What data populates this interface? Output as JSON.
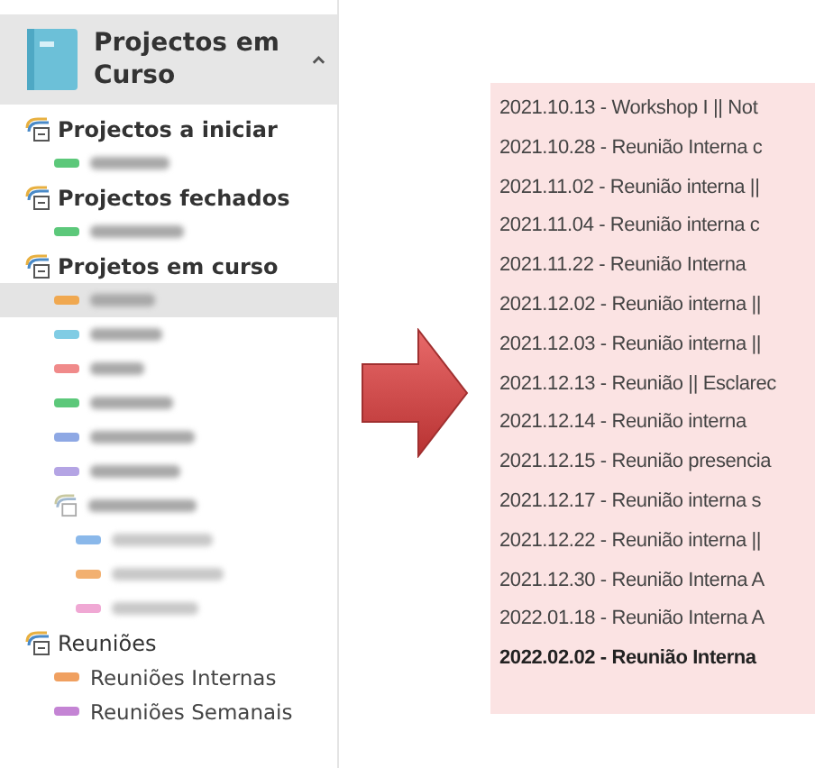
{
  "sidebar": {
    "header": {
      "title": "Projectos em Curso",
      "expanded": true
    },
    "sections": [
      {
        "label": "Projectos a iniciar",
        "bold": true,
        "children": [
          {
            "kind": "calendar",
            "color": "#5cc87a",
            "selected": false
          }
        ]
      },
      {
        "label": "Projectos fechados",
        "bold": true,
        "children": [
          {
            "kind": "calendar",
            "color": "#5cc87a",
            "selected": false
          }
        ]
      },
      {
        "label": "Projetos em curso",
        "bold": true,
        "children": [
          {
            "kind": "calendar",
            "color": "#f0a850",
            "selected": true
          },
          {
            "kind": "calendar",
            "color": "#80cce4",
            "selected": false
          },
          {
            "kind": "calendar",
            "color": "#f08a8a",
            "selected": false
          },
          {
            "kind": "calendar",
            "color": "#5cc87a",
            "selected": false
          },
          {
            "kind": "calendar",
            "color": "#8ea8e4",
            "selected": false
          },
          {
            "kind": "calendar",
            "color": "#b4a4e4",
            "selected": false
          },
          {
            "kind": "group",
            "selected": false,
            "children": [
              {
                "color": "#8ab8ea",
                "selected": false
              },
              {
                "color": "#f2b070",
                "selected": false
              },
              {
                "color": "#f0a8d4",
                "selected": false
              }
            ]
          }
        ]
      },
      {
        "label": "Reuniões",
        "bold": false,
        "children": [
          {
            "kind": "calendar",
            "label": "Reuniões Internas",
            "color": "#f0a060",
            "selected": false
          },
          {
            "kind": "calendar",
            "label": "Reuniões Semanais",
            "color": "#c484d4",
            "selected": false
          }
        ]
      }
    ]
  },
  "meetings": [
    {
      "text": "2021.10.13 - Workshop I || Not",
      "unread": false
    },
    {
      "text": "2021.10.28 - Reunião Interna c",
      "unread": false
    },
    {
      "text": "2021.11.02 - Reunião interna ||",
      "unread": false
    },
    {
      "text": "2021.11.04 - Reunião interna c",
      "unread": false
    },
    {
      "text": "2021.11.22 - Reunião Interna",
      "unread": false
    },
    {
      "text": "2021.12.02 - Reunião interna ||",
      "unread": false
    },
    {
      "text": "2021.12.03 - Reunião interna ||",
      "unread": false
    },
    {
      "text": "2021.12.13 - Reunião || Esclarec",
      "unread": false
    },
    {
      "text": "2021.12.14 - Reunião interna",
      "unread": false
    },
    {
      "text": "2021.12.15 - Reunião presencia",
      "unread": false
    },
    {
      "text": "2021.12.17 - Reunião interna s",
      "unread": false
    },
    {
      "text": "2021.12.22 - Reunião interna ||",
      "unread": false
    },
    {
      "text": "2021.12.30 - Reunião Interna A",
      "unread": false
    },
    {
      "text": "2022.01.18 - Reunião Interna A",
      "unread": false
    },
    {
      "text": "2022.02.02 - Reunião Interna",
      "unread": true
    }
  ]
}
